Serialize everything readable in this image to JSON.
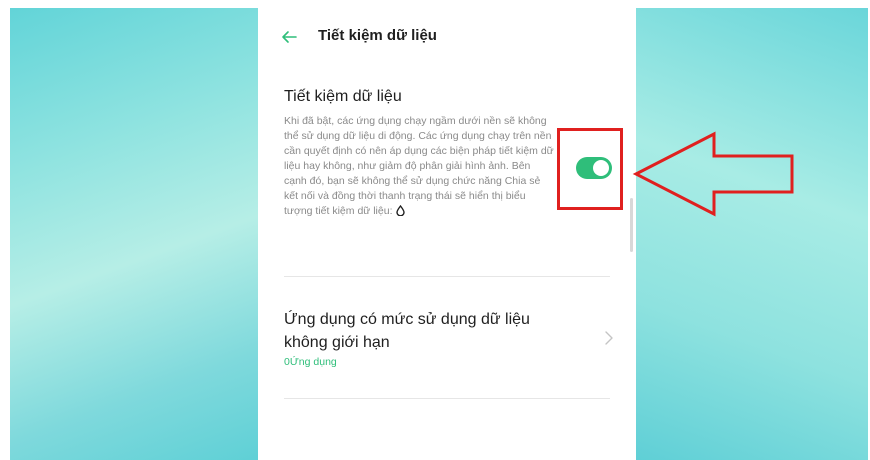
{
  "header": {
    "title": "Tiết kiệm dữ liệu"
  },
  "data_saver": {
    "title": "Tiết kiệm dữ liệu",
    "description": "Khi đã bật, các ứng dụng chạy ngầm dưới nền sẽ không thể sử dụng dữ liệu di động. Các ứng dụng chạy trên nền cần quyết định có nên áp dụng các biện pháp tiết kiệm dữ liệu hay không, như giảm độ phân giải hình ảnh. Bên cạnh đó, bạn sẽ không thể sử dụng chức năng Chia sẻ kết nối và đồng thời thanh trạng thái sẽ hiển thị biểu tượng tiết kiệm dữ liệu:",
    "status_icon": "data-saver-drop-icon",
    "toggle_on": true
  },
  "unrestricted": {
    "title": "Ứng dụng có mức sử dụng dữ liệu không giới hạn",
    "subtitle": "0Ứng dụng"
  },
  "colors": {
    "accent": "#2fbe7a",
    "annotation": "#e0201f",
    "background_teal": "#7fd9dc"
  }
}
